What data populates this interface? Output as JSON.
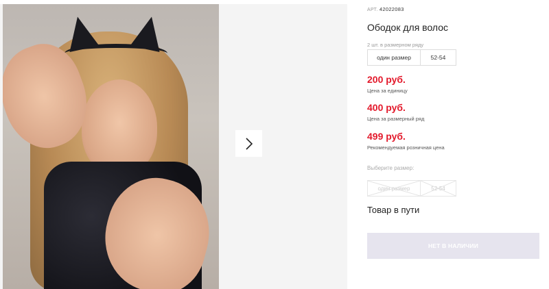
{
  "product": {
    "article_label": "АРТ.",
    "article_number": "42022083",
    "title": "Ободок для волос"
  },
  "size_row": {
    "note": "2 шт. в размерном ряду",
    "sizes": [
      "один размер",
      "52-54"
    ]
  },
  "prices": [
    {
      "value": "200 руб.",
      "note": "Цена за единицу"
    },
    {
      "value": "400 руб.",
      "note": "Цена за размерный ряд"
    },
    {
      "value": "499 руб.",
      "note": "Рекомендуемая розничная цена"
    }
  ],
  "size_select": {
    "label": "Выберите размер:",
    "options": [
      "один размер",
      "52-54"
    ]
  },
  "status": "Товар в пути",
  "buy_button": "НЕТ В НАЛИЧИИ",
  "colors": {
    "price": "#e3192b",
    "disabled_button": "#e6e4ee"
  },
  "icons": {
    "next": "chevron-right-icon"
  }
}
